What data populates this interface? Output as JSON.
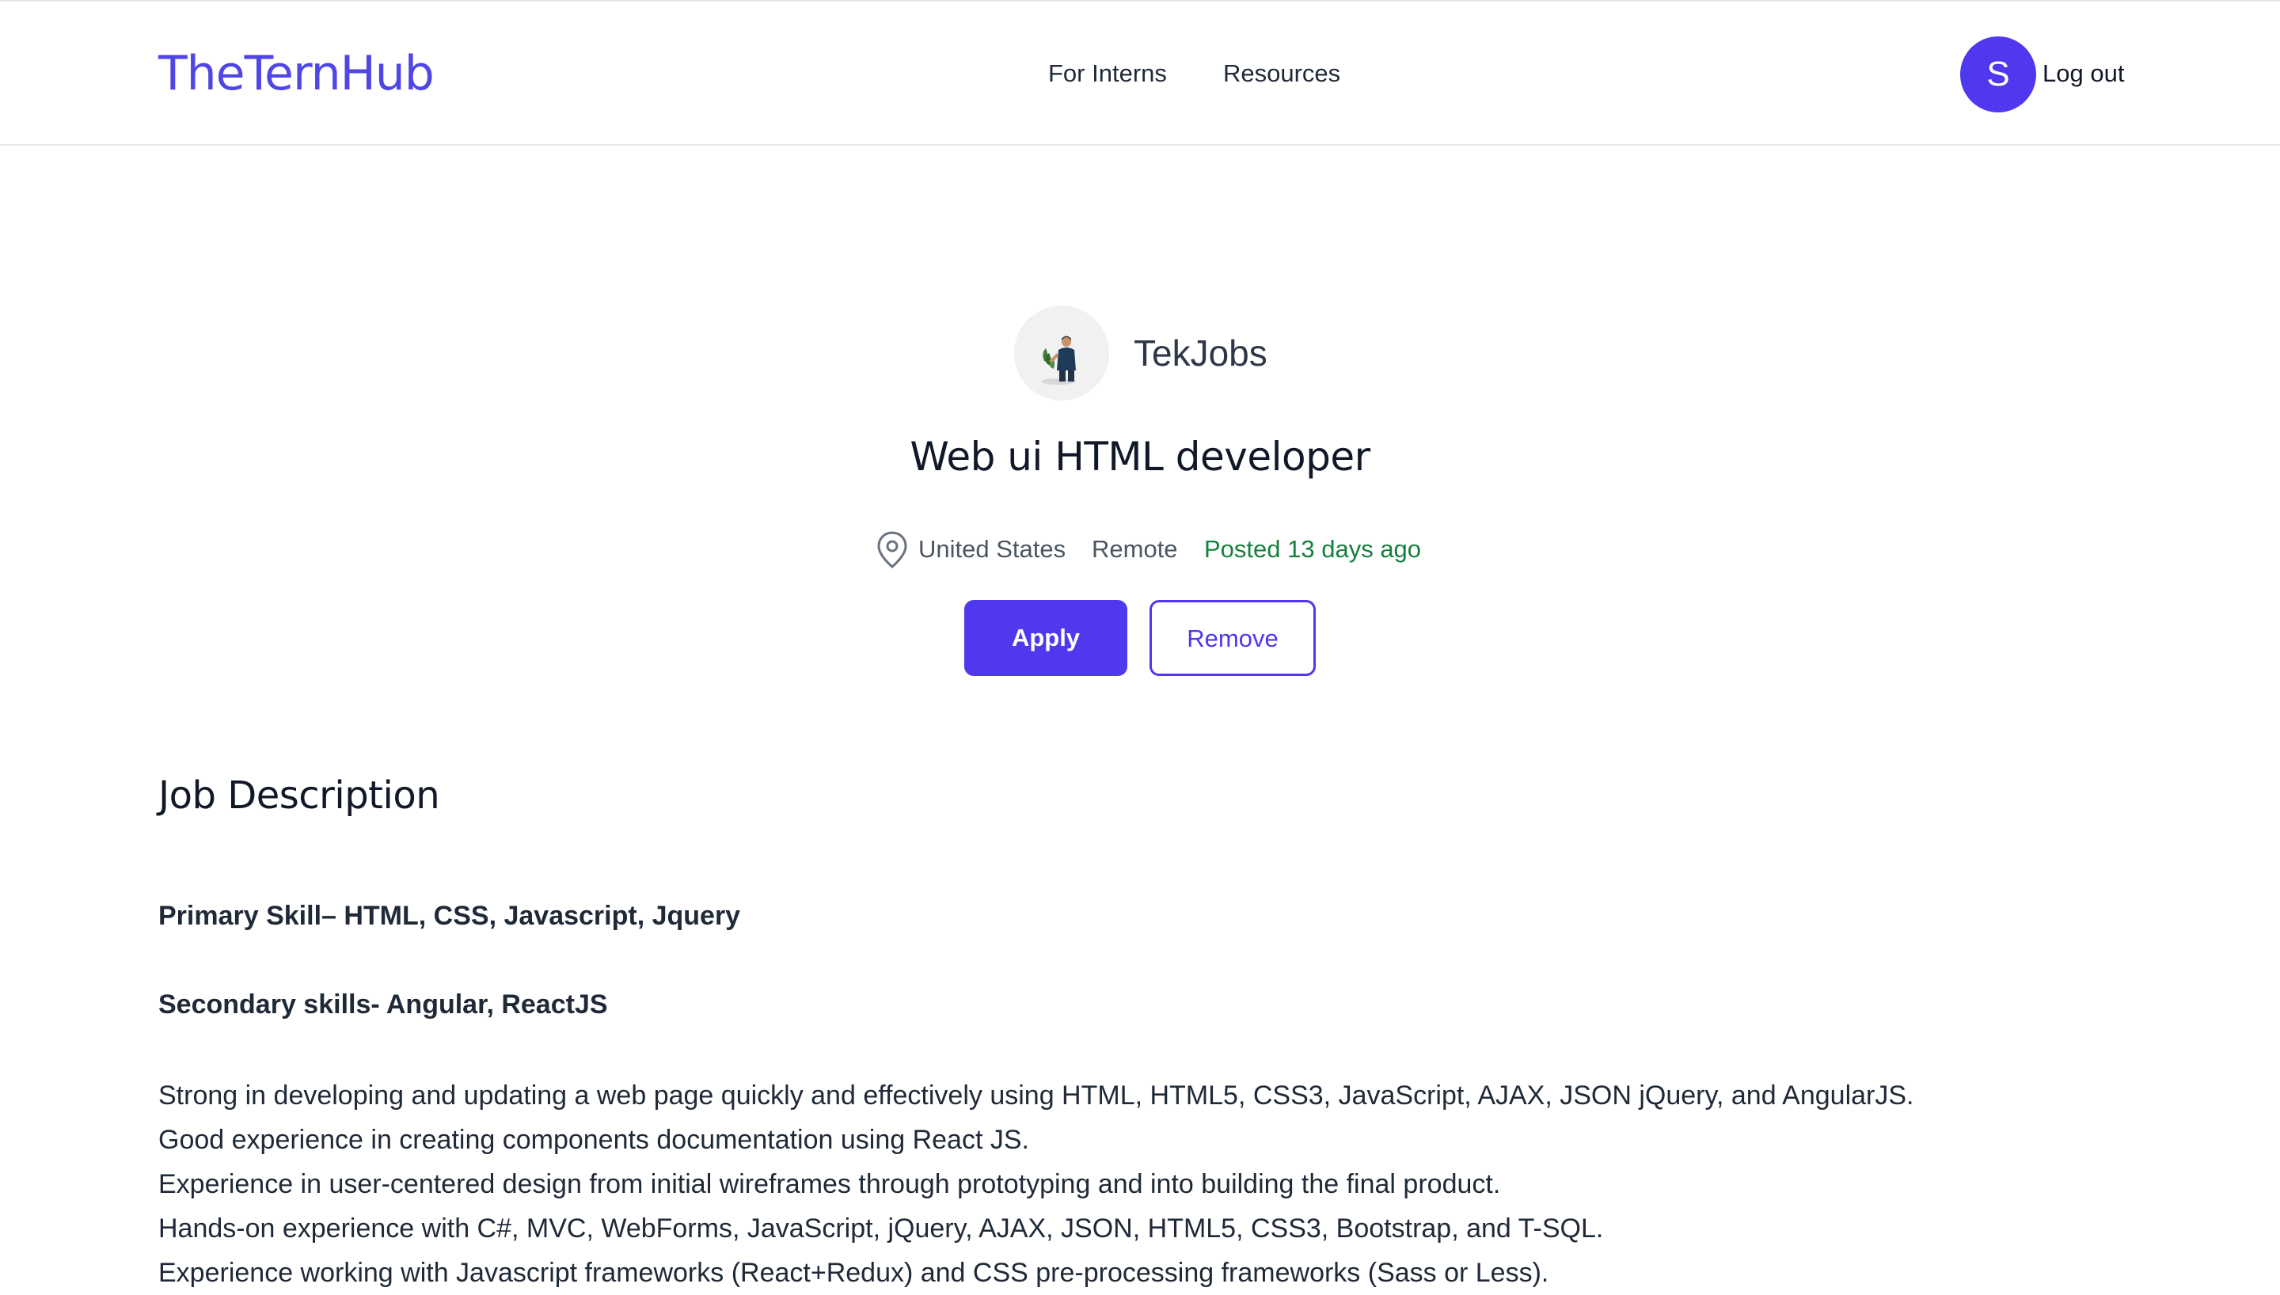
{
  "header": {
    "logo": "TheTernHub",
    "nav": {
      "for_interns": "For Interns",
      "resources": "Resources"
    },
    "avatar_initial": "S",
    "logout_label": "Log out"
  },
  "job": {
    "company_name": "TekJobs",
    "title": "Web ui HTML developer",
    "location_icon": "map-pin-icon",
    "location": "United States",
    "work_type": "Remote",
    "posted": "Posted 13 days ago",
    "apply_label": "Apply",
    "remove_label": "Remove"
  },
  "description": {
    "heading": "Job Description",
    "primary_skill": "Primary Skill– HTML, CSS, Javascript, Jquery",
    "secondary_skills": "Secondary skills- Angular, ReactJS",
    "lines": [
      "Strong in developing and updating a web page quickly and effectively using HTML, HTML5, CSS3, JavaScript, AJAX, JSON jQuery, and AngularJS.",
      "Good experience in creating components documentation using React JS.",
      "Experience in user-centered design from initial wireframes through prototyping and into building the final product.",
      "Hands-on experience with C#, MVC, WebForms, JavaScript, jQuery, AJAX, JSON, HTML5, CSS3, Bootstrap, and T-SQL.",
      "Experience working with Javascript frameworks (React+Redux) and CSS pre-processing frameworks (Sass or Less)."
    ]
  },
  "colors": {
    "brand": "#4f46e5",
    "button_primary": "#4f38ee",
    "posted_green": "#15803d"
  }
}
